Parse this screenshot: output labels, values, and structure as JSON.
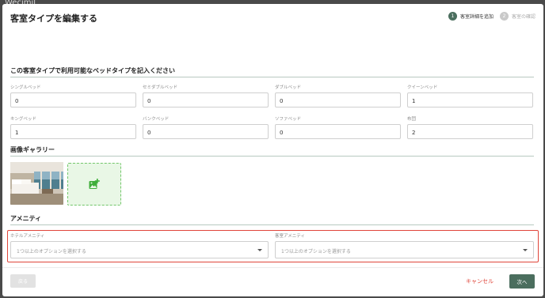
{
  "background": {
    "app_title": "Wecimil"
  },
  "modal": {
    "title": "客室タイプを編集する",
    "steps": [
      {
        "number": "1",
        "label": "客室詳細を追加",
        "state": "active"
      },
      {
        "number": "2",
        "label": "客室の確認",
        "state": "inactive"
      }
    ]
  },
  "beds": {
    "section_title": "この客室タイプで利用可能なベッドタイプを記入ください",
    "fields": [
      {
        "label": "シングルベッド",
        "value": "0"
      },
      {
        "label": "セミダブルベッド",
        "value": "0"
      },
      {
        "label": "ダブルベッド",
        "value": "0"
      },
      {
        "label": "クイーンベッド",
        "value": "1"
      },
      {
        "label": "キングベッド",
        "value": "1"
      },
      {
        "label": "バンクベッド",
        "value": "0"
      },
      {
        "label": "ソファベッド",
        "value": "0"
      },
      {
        "label": "布団",
        "value": "2"
      }
    ]
  },
  "gallery": {
    "section_title": "画像ギャラリー",
    "add_icon": "add-image-icon"
  },
  "amenities": {
    "section_title": "アメニティ",
    "hotel": {
      "label": "ホテルアメニティ",
      "placeholder": "1つ以上のオプションを選択する"
    },
    "room": {
      "label": "客室アメニティ",
      "placeholder": "1つ以上のオプションを選択する"
    }
  },
  "footer": {
    "back_label": "戻る",
    "cancel_label": "キャンセル",
    "next_label": "次へ"
  },
  "colors": {
    "accent": "#4b6e5e",
    "cancel": "#e04a3f",
    "highlight": "#e0453a",
    "add_tile_bg": "#e9f7e6",
    "add_tile_border": "#72c66a"
  }
}
